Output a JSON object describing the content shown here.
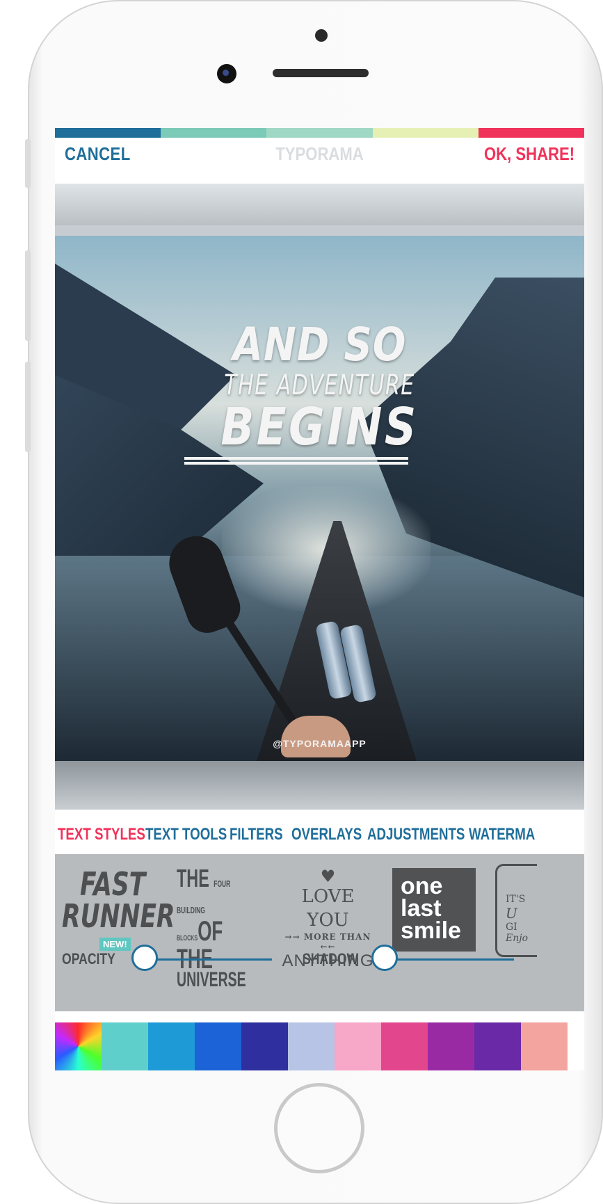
{
  "app": {
    "title": "TYPORAMA",
    "cancel_label": "CANCEL",
    "share_label": "OK, SHARE!"
  },
  "colors": {
    "accent_blue": "#1f6e9a",
    "accent_pink": "#f0325a",
    "stripe": [
      "#1f6e9a",
      "#7ccab8",
      "#9fd8c4",
      "#e6f0b4",
      "#f0325a"
    ]
  },
  "canvas": {
    "text_line1": "AND SO",
    "text_line2": "THE ADVENTURE",
    "text_line3": "BEGINS",
    "watermark": "@TYPORAMAAPP"
  },
  "tabs": [
    {
      "label": "TEXT STYLES",
      "active": true
    },
    {
      "label": "TEXT TOOLS",
      "active": false
    },
    {
      "label": "FILTERS",
      "active": false
    },
    {
      "label": "OVERLAYS",
      "active": false
    },
    {
      "label": "ADJUSTMENTS",
      "active": false
    },
    {
      "label": "WATERMA",
      "active": false
    }
  ],
  "styles": {
    "fast_runner": {
      "line1": "FAST",
      "line2": "RUNNER",
      "badge": "NEW!"
    },
    "the_four": {
      "line1": "THE",
      "line1b": "FOUR BUILDING",
      "line2a": "BLOCKS",
      "line2": "OF THE",
      "line3": "UNIVERSE"
    },
    "love_you": {
      "icon": "heart-icon",
      "line1": "LOVE YOU",
      "line2": "MORE THAN",
      "line3": "ANYTHING"
    },
    "one_last": {
      "line1": "one",
      "line2": "last",
      "line3": "smile"
    },
    "partial": {
      "line1": "IT'S",
      "line2": "U",
      "line3": "GI",
      "line4": "Enjo"
    }
  },
  "sliders": {
    "opacity_label": "OPACITY",
    "opacity_value": 0,
    "shadow_label": "SHADOW",
    "shadow_value": 0
  },
  "palette": [
    "#5fcfcc",
    "#1e9bd6",
    "#1b63d7",
    "#2f2fa0",
    "#b7c4e6",
    "#f7a7c7",
    "#e2468c",
    "#9a2aa4",
    "#6a2aa8",
    "#f3a49f"
  ]
}
